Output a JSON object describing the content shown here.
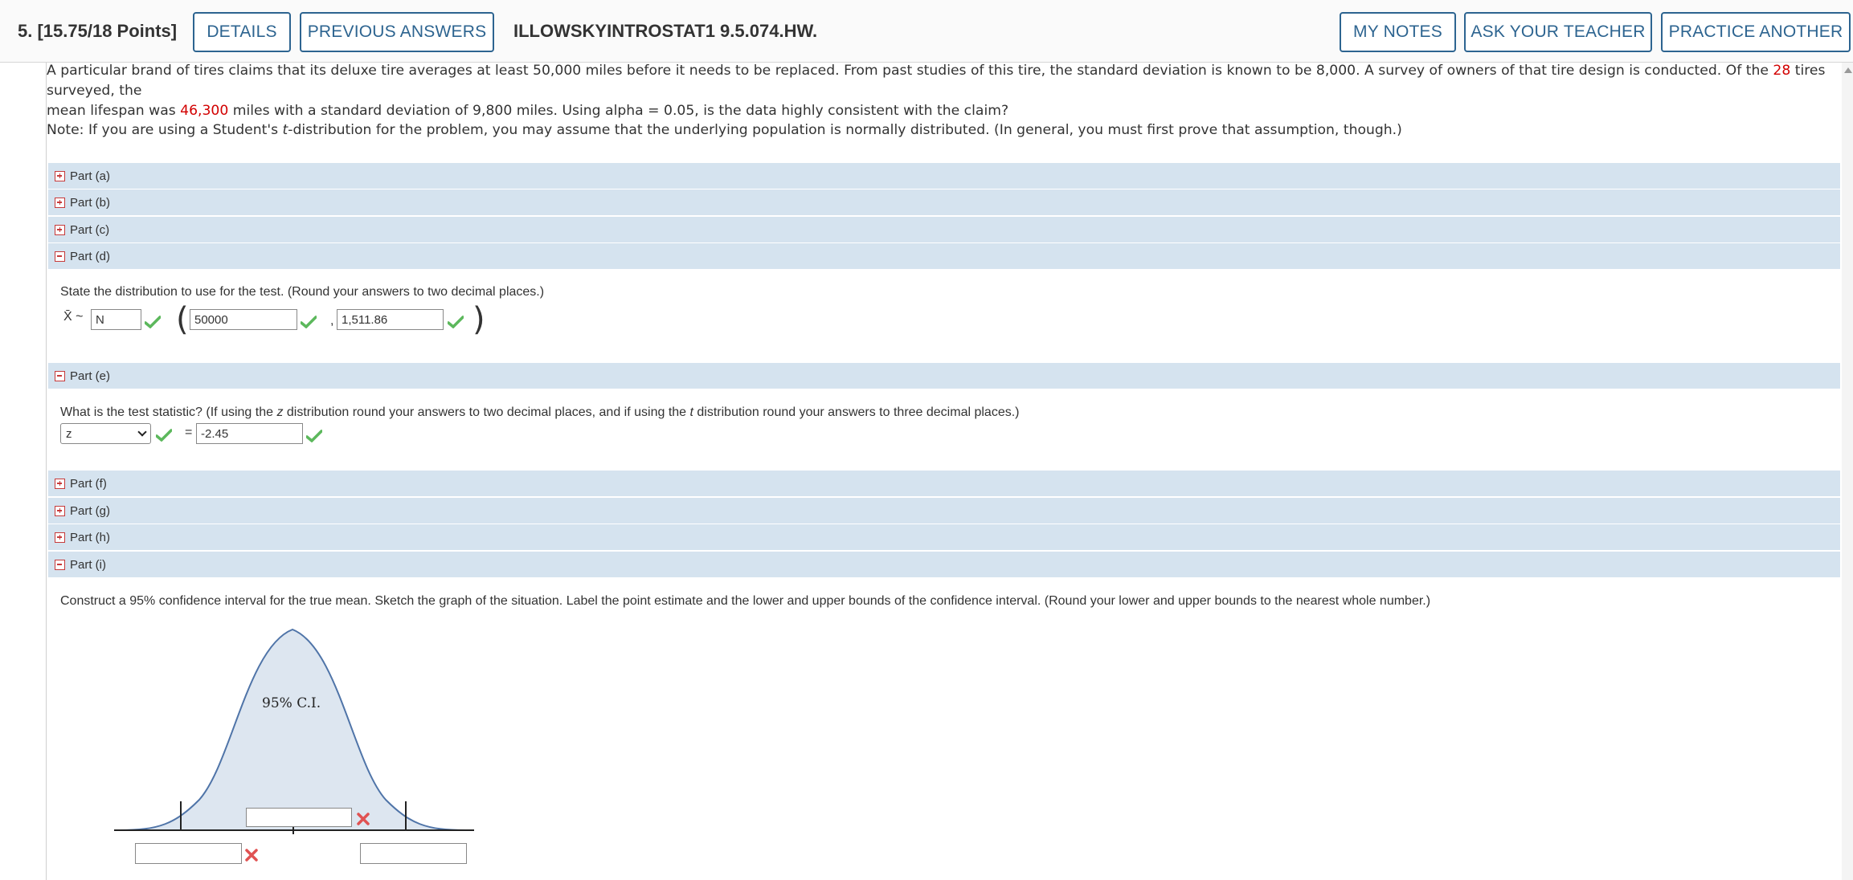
{
  "header": {
    "question_number": "5.",
    "points": "[15.75/18 Points]",
    "details_button": "DETAILS",
    "previous_answers_button": "PREVIOUS ANSWERS",
    "assignment_id": "ILLOWSKYINTROSTAT1 9.5.074.HW.",
    "my_notes_button": "MY NOTES",
    "ask_teacher_button": "ASK YOUR TEACHER",
    "practice_button": "PRACTICE ANOTHER"
  },
  "prompt": {
    "line1_a": "A particular brand of tires claims that its deluxe tire averages at least 50,000 miles before it needs to be replaced. From past studies of this tire, the standard deviation is known to be 8,000. A survey of owners of that tire design is conducted. Of the ",
    "line1_hl": "28",
    "line1_b": " tires surveyed, the",
    "line2_a": "mean lifespan was ",
    "line2_hl": "46,300",
    "line2_b": " miles with a standard deviation of 9,800 miles. Using alpha = 0.05, is the data highly consistent with the claim?",
    "note_a": "Note: If you are using a Student's ",
    "note_t": "t",
    "note_b": "-distribution for the problem, you may assume that the underlying population is normally distributed. (In general, you must first prove that assumption, though.)"
  },
  "parts": {
    "a": "Part (a)",
    "b": "Part (b)",
    "c": "Part (c)",
    "d": "Part (d)",
    "e": "Part (e)",
    "f": "Part (f)",
    "g": "Part (g)",
    "h": "Part (h)",
    "i": "Part (i)"
  },
  "part_d": {
    "instruction": "State the distribution to use for the test. (Round your answers to two decimal places.)",
    "xbar_symbol": "X̄",
    "tilde": "~",
    "distribution": "N",
    "mean": "50000",
    "comma": ",",
    "std_error": "1,511.86"
  },
  "part_e": {
    "instruction_a": "What is the test statistic? (If using the ",
    "instruction_z": "z",
    "instruction_b": " distribution round your answers to two decimal places, and if using the ",
    "instruction_t": "t",
    "instruction_c": " distribution round your answers to three decimal places.)",
    "selected_distribution": "z",
    "equals": "=",
    "statistic": "-2.45"
  },
  "part_i": {
    "instruction": "Construct a 95% confidence interval for the true mean. Sketch the graph of the situation. Label the point estimate and the lower and upper bounds of the confidence interval. (Round your lower and upper bounds to the nearest whole number.)",
    "graph_label": "95% C.I.",
    "point_estimate": "",
    "lower_bound": "",
    "upper_bound": ""
  },
  "colors": {
    "accent": "#2d6490",
    "part_bar": "#d5e3ef",
    "highlight": "#d20000",
    "check": "#5cb85c",
    "cross": "#e05252",
    "curve_fill": "#dde6f0",
    "curve_stroke": "#4f74a8"
  }
}
